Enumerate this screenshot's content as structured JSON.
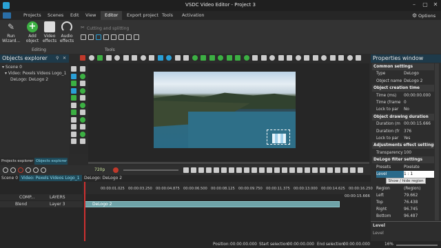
{
  "window": {
    "title": "VSDC Video Editor - Project 3",
    "options": "Options"
  },
  "menu": [
    "Projects",
    "Scenes",
    "Edit",
    "View",
    "Editor",
    "Export project",
    "Tools",
    "Activation"
  ],
  "ribbon": {
    "run_wizard": "Run Wizard...",
    "add_object": "Add object",
    "video_effects": "Video effects",
    "audio_effects": "Audio effects",
    "cutting": "Cutting and splitting",
    "editing_label": "Editing",
    "tools_label": "Tools"
  },
  "objects_explorer": {
    "title": "Objects explorer",
    "items": [
      "Scene 0",
      "Video: Pexels Videos Logo_1",
      "DeLogo: DeLogo 2"
    ],
    "tabs": [
      "Projects explorer",
      "Objects explorer"
    ]
  },
  "properties": {
    "title": "Properties window",
    "rows": [
      {
        "t": "sec",
        "k": "Common settings"
      },
      {
        "k": "Type",
        "v": "DeLogo"
      },
      {
        "k": "Object name",
        "v": "DeLogo 2"
      },
      {
        "t": "sec",
        "k": "Object creation time"
      },
      {
        "k": "Time (ms)",
        "v": "00:00:00.000"
      },
      {
        "k": "Time (frame",
        "v": "0"
      },
      {
        "k": "Lock to par",
        "v": "No"
      },
      {
        "t": "sec",
        "k": "Object drawing duration"
      },
      {
        "k": "Duration (m",
        "v": "00:00:15.666"
      },
      {
        "k": "Duration (fr",
        "v": "376"
      },
      {
        "k": "Lock to par",
        "v": "Yes"
      },
      {
        "t": "sec",
        "k": "Adjustments effect settings"
      },
      {
        "k": "Transparency",
        "v": "100"
      },
      {
        "t": "sec",
        "k": "DeLogo filter settings"
      },
      {
        "k": "Presets",
        "v": "Pixelate"
      },
      {
        "k": "Level",
        "v": "1 : 1"
      }
    ],
    "show_hide": "Show / hide region",
    "region_rows": [
      {
        "k": "Region",
        "v": "(Region)"
      },
      {
        "k": "Left",
        "v": "79.662"
      },
      {
        "k": "Top",
        "v": "76.438"
      },
      {
        "k": "Right",
        "v": "96.745"
      },
      {
        "k": "Bottom",
        "v": "96.487"
      }
    ],
    "help_title": "Level",
    "help_text": "Level"
  },
  "transport": {
    "quality": "720p"
  },
  "timeline": {
    "tabs": [
      "Scene 0",
      "Video: Pexels Videos Logo_1",
      "DeLogo: DeLogo 2"
    ],
    "ruler": [
      "00:00:01.025",
      "00:00:03.250",
      "00:00:04.875",
      "00:00:06.500",
      "00:00:08.125",
      "00:00:09.750",
      "00:00:11.375",
      "00:00:13.000",
      "00:00:14.625",
      "00:00:16.250"
    ],
    "end_time": "00:00:15.666",
    "header": {
      "comp": "COMP...",
      "layers": "LAYERS"
    },
    "track": {
      "blend": "Blend",
      "layer": "Layer 3",
      "clip": "DeLogo 2"
    }
  },
  "status": {
    "position_label": "Position:",
    "position": "00:00:00.000",
    "start_label": "Start selection:",
    "start": "00:00:00.000",
    "end_label": "End selection:",
    "end": "00:00:00.000",
    "zoom": "16%"
  }
}
